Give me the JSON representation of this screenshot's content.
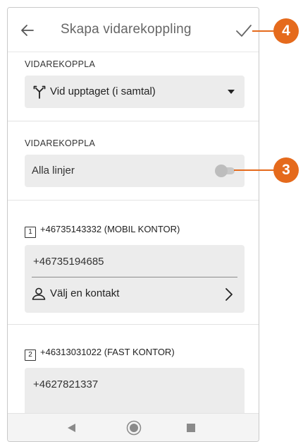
{
  "header": {
    "title": "Skapa vidarekoppling",
    "back_icon": "arrow-left-icon",
    "confirm_icon": "check-icon"
  },
  "forward_type": {
    "label": "VIDAREKOPPLA",
    "value": "Vid upptaget (i samtal)",
    "icon": "forward-split-icon"
  },
  "forward_lines": {
    "label": "VIDAREKOPPLA",
    "value": "Alla linjer",
    "enabled": false
  },
  "lines": [
    {
      "index": "1",
      "header": "+46735143332 (MOBIL KONTOR)",
      "number": "+46735194685",
      "contact_label": "Välj en kontakt"
    },
    {
      "index": "2",
      "header": "+46313031022 (FAST KONTOR)",
      "number": "+4627821337"
    }
  ],
  "callouts": {
    "toggle": "3",
    "confirm": "4"
  },
  "colors": {
    "callout": "#e56a1c",
    "field_bg": "#ececec"
  }
}
